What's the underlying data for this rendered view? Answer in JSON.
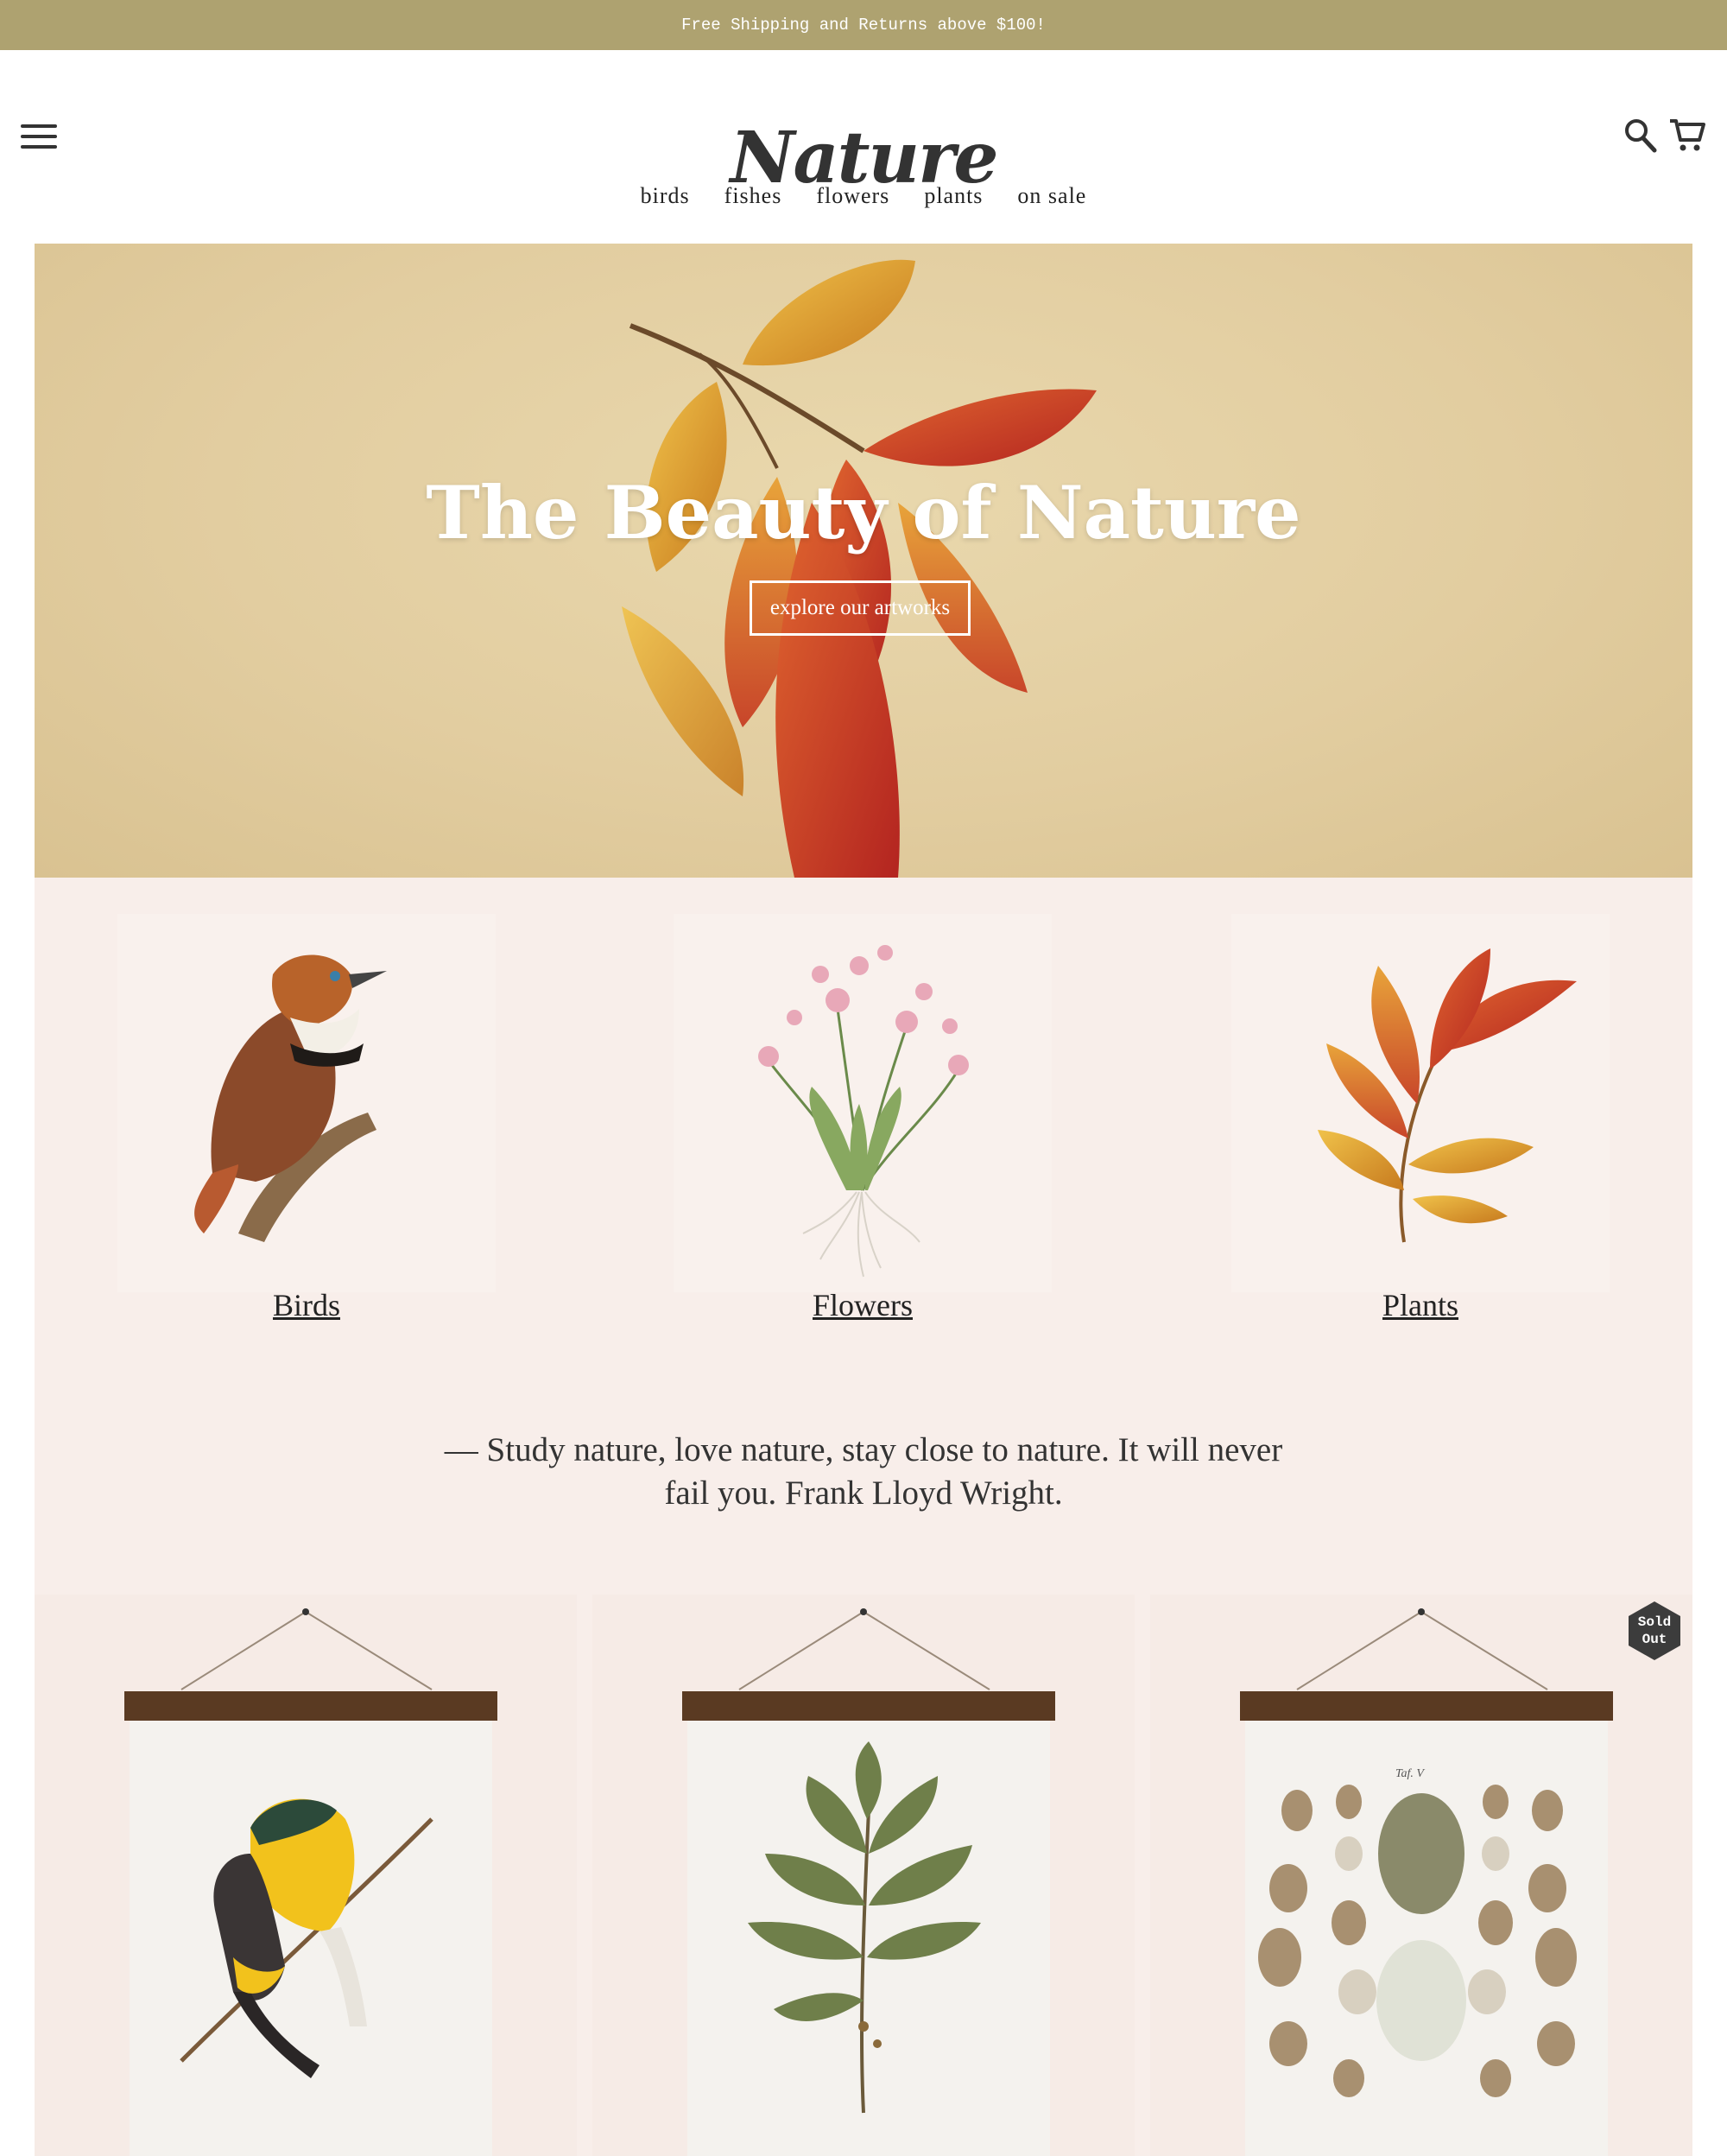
{
  "announcement": "Free Shipping and Returns above $100!",
  "header": {
    "logo_text": "Nature",
    "nav": [
      "birds",
      "fishes",
      "flowers",
      "plants",
      "on sale"
    ]
  },
  "hero": {
    "title": "The Beauty of Nature",
    "button": "explore our artworks"
  },
  "categories": [
    {
      "label": "Birds"
    },
    {
      "label": "Flowers"
    },
    {
      "label": "Plants"
    }
  ],
  "quote": "— Study nature, love nature, stay close to nature. It will never fail you. Frank Lloyd Wright.",
  "products": [
    {
      "art": "bird print"
    },
    {
      "art": "plant print"
    },
    {
      "art": "eggs print",
      "plate_label": "Taf. V",
      "badge": "Sold Out"
    }
  ],
  "colors": {
    "announcement_bg": "#aea270",
    "hero_bg": "#e2cda0",
    "content_bg": "#f8eeea",
    "frame_wood": "#5a3a22"
  },
  "icons": [
    "menu-icon",
    "search-icon",
    "cart-icon"
  ]
}
